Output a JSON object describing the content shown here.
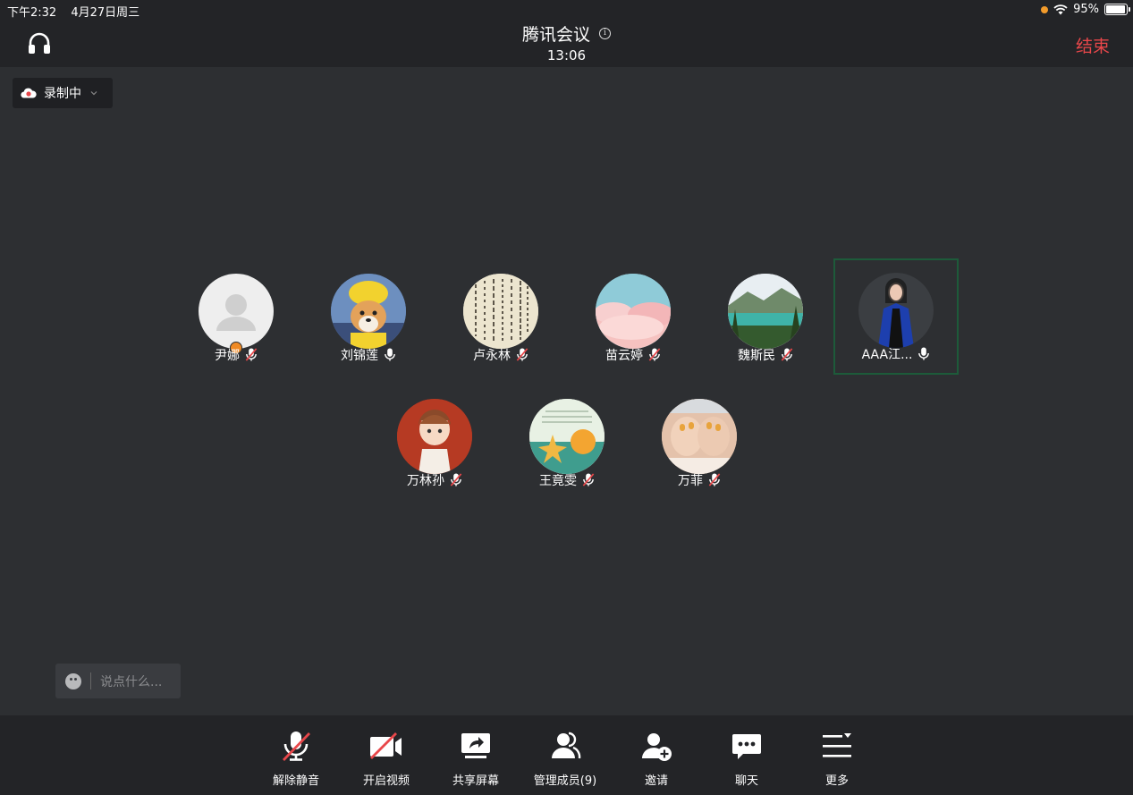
{
  "status_bar": {
    "time": "下午2:32",
    "date": "4月27日周三",
    "battery": "95%",
    "battery_level": 0.95
  },
  "header": {
    "title": "腾讯会议",
    "timer": "13:06",
    "end_label": "结束"
  },
  "recording": {
    "label": "录制中"
  },
  "participants": [
    {
      "name": "尹娜",
      "mic": "muted",
      "avatar": "default-person-icon",
      "host": true
    },
    {
      "name": "刘锦莲",
      "mic": "on",
      "avatar": "shiba-dog-photo"
    },
    {
      "name": "卢永林",
      "mic": "muted",
      "avatar": "calligraphy-photo"
    },
    {
      "name": "苗云婷",
      "mic": "muted",
      "avatar": "pink-clouds-photo"
    },
    {
      "name": "魏斯民",
      "mic": "muted",
      "avatar": "mountain-lake-photo"
    },
    {
      "name": "AAA江...",
      "mic": "on",
      "avatar": "graduate-photo",
      "active": true
    },
    {
      "name": "万林孙",
      "mic": "muted",
      "avatar": "cartoon-boy-photo"
    },
    {
      "name": "王竟雯",
      "mic": "muted",
      "avatar": "starfish-photo"
    },
    {
      "name": "万菲",
      "mic": "muted",
      "avatar": "hands-photo"
    }
  ],
  "chat": {
    "placeholder": "说点什么..."
  },
  "toolbar": {
    "unmute_label": "解除静音",
    "video_label": "开启视频",
    "share_label": "共享屏幕",
    "members_label": "管理成员(9)",
    "invite_label": "邀请",
    "chat_label": "聊天",
    "more_label": "更多"
  },
  "colors": {
    "background": "#2d2f32",
    "bar": "#232427",
    "end_red": "#e8474a",
    "mute_red": "#e8474a",
    "active_border": "#1d5b3a",
    "host_orange": "#f08a24"
  }
}
